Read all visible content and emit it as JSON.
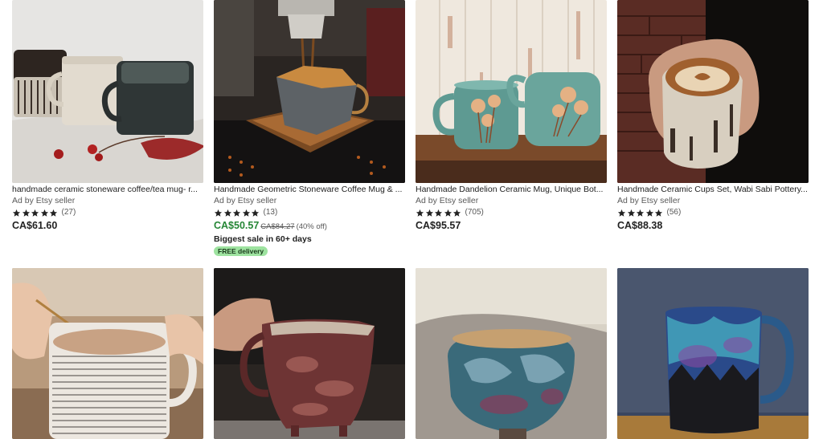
{
  "listings": [
    {
      "title": "handmade ceramic stoneware coffee/tea mug- r...",
      "seller": "Ad by Etsy seller",
      "rating": 5,
      "reviews": "(27)",
      "price": "CA$61.60",
      "image_icon": "stoneware-mugs-image"
    },
    {
      "title": "Handmade Geometric Stoneware Coffee Mug & ...",
      "seller": "Ad by Etsy seller",
      "rating": 5,
      "reviews": "(13)",
      "price": "CA$50.57",
      "original_price": "CA$84.27",
      "discount": "(40% off)",
      "promo": "Biggest sale in 60+ days",
      "badge": "FREE delivery",
      "image_icon": "geometric-mug-espresso-image"
    },
    {
      "title": "Handmade Dandelion Ceramic Mug, Unique Bot...",
      "seller": "Ad by Etsy seller",
      "rating": 5,
      "reviews": "(705)",
      "price": "CA$95.57",
      "image_icon": "dandelion-mugs-image"
    },
    {
      "title": "Handmade Ceramic Cups Set, Wabi Sabi Pottery...",
      "seller": "Ad by Etsy seller",
      "rating": 5,
      "reviews": "(56)",
      "price": "CA$88.38",
      "image_icon": "wabi-sabi-cup-image"
    }
  ],
  "bottom_row": [
    {
      "image_icon": "striped-mug-image"
    },
    {
      "image_icon": "raku-jug-image"
    },
    {
      "image_icon": "blue-bowl-image"
    },
    {
      "image_icon": "galaxy-mug-image"
    }
  ],
  "colors": {
    "sale_price": "#258635",
    "star": "#222222",
    "badge_bg": "#9ee3a0",
    "muted_text": "#595959"
  }
}
